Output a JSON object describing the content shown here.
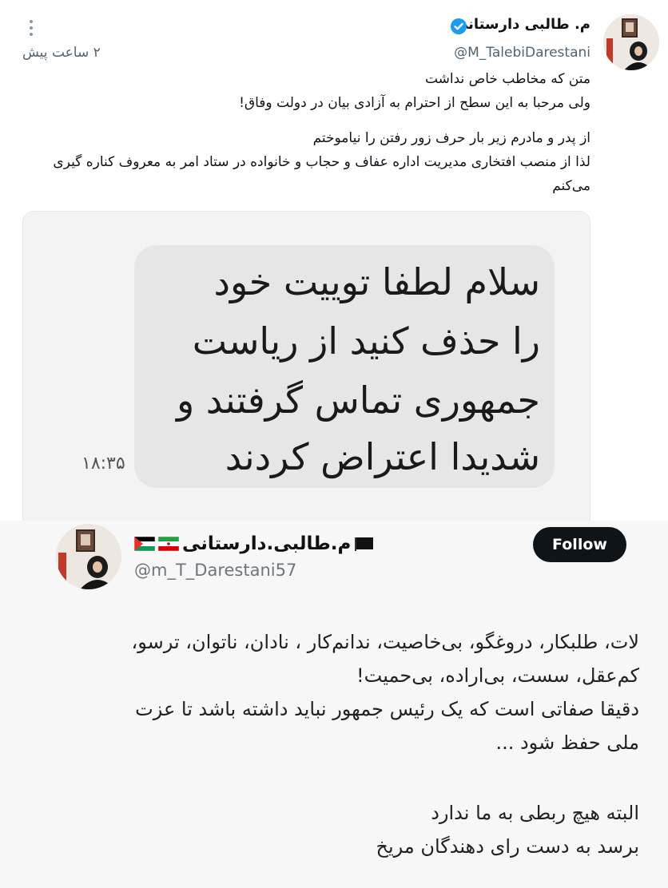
{
  "tweet1": {
    "display_name": "م. طالبی دارستانی",
    "handle": "@M_TalebiDarestani",
    "time_ago": "۲ ساعت پیش",
    "verified": true,
    "text_lines": [
      "متن که مخاطب خاص نداشت",
      "ولی مرحبا به این سطح از احترام به آزادی بیان در دولت وفاق!",
      "از پدر و مادرم زیر بار حرف زور رفتن را نیاموختم",
      "لذا از منصب افتخاری مدیریت اداره عفاف و حجاب و خانواده در ستاد امر به معروف کناره گیری",
      "می‌کنم"
    ],
    "attached_message": {
      "lines": [
        "سلام لطفا توییت خود",
        "را حذف کنید از ریاست",
        "جمهوری تماس گرفتند و",
        "شدیدا اعتراض کردند"
      ],
      "time": "۱۸:۳۵"
    }
  },
  "tweet2": {
    "display_name": "م.طالبی.دارستانی",
    "handle": "@m_T_Darestani57",
    "follow_label": "Follow",
    "flags": [
      "black-flag-icon",
      "iran-flag-icon",
      "palestine-flag-icon"
    ],
    "text_lines": [
      "لات، طلبکار، دروغگو، بی‌خاصیت، ندانم‌کار ، نادان، ناتوان، ترسو،",
      "کم‌عقل، سست، بی‌اراده، بی‌حمیت!",
      "دقیقا صفاتی است که یک رئیس جمهور نباید داشته باشد تا عزت",
      "ملی حفظ شود ...",
      "البته هیچ ربطی به ما ندارد",
      "برسد به دست رای دهندگان مریخ"
    ]
  },
  "colors": {
    "text_primary": "#0f1419",
    "text_secondary": "#536471",
    "verified_blue": "#1d9bf0",
    "bubble_bg": "#e6e6e6",
    "follow_bg": "#0f1419"
  }
}
